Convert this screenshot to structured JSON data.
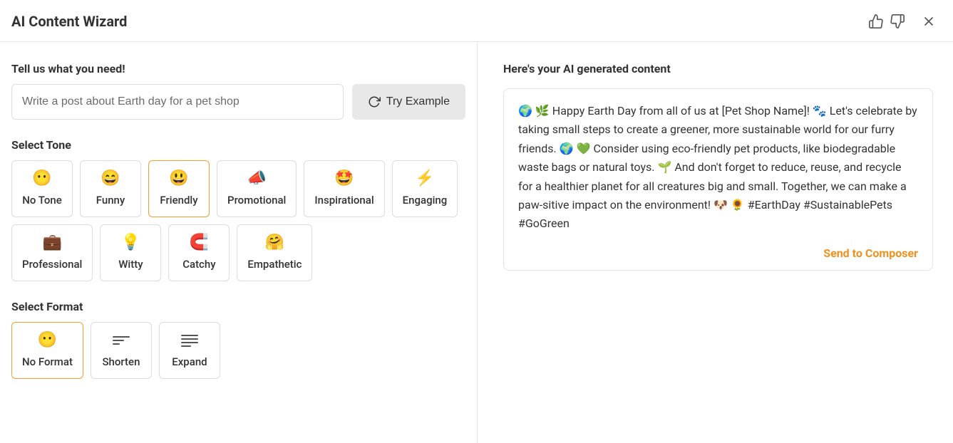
{
  "header": {
    "title": "AI Content Wizard"
  },
  "left": {
    "prompt_label": "Tell us what you need!",
    "prompt_value": "Write a post about Earth day for a pet shop",
    "try_example_label": "Try Example",
    "tone_label": "Select Tone",
    "tones": [
      {
        "emoji": "😶",
        "label": "No Tone",
        "selected": false
      },
      {
        "emoji": "😄",
        "label": "Funny",
        "selected": false
      },
      {
        "emoji": "😃",
        "label": "Friendly",
        "selected": true
      },
      {
        "emoji": "📣",
        "label": "Promotional",
        "selected": false
      },
      {
        "emoji": "🤩",
        "label": "Inspirational",
        "selected": false
      },
      {
        "emoji": "⚡",
        "label": "Engaging",
        "selected": false
      },
      {
        "emoji": "💼",
        "label": "Professional",
        "selected": false
      },
      {
        "emoji": "💡",
        "label": "Witty",
        "selected": false
      },
      {
        "emoji": "🧲",
        "label": "Catchy",
        "selected": false
      },
      {
        "emoji": "🤗",
        "label": "Empathetic",
        "selected": false
      }
    ],
    "format_label": "Select Format",
    "formats": [
      {
        "icon": "emoji",
        "emoji": "😶",
        "label": "No Format",
        "selected": true
      },
      {
        "icon": "shorten",
        "label": "Shorten",
        "selected": false
      },
      {
        "icon": "expand",
        "label": "Expand",
        "selected": false
      }
    ]
  },
  "right": {
    "title": "Here's your AI generated content",
    "output": "🌍 🌿 Happy Earth Day from all of us at [Pet Shop Name]! 🐾 Let's celebrate by taking small steps to create a greener, more sustainable world for our furry friends. 🌍 💚 Consider using eco-friendly pet products, like biodegradable waste bags or natural toys. 🌱 And don't forget to reduce, reuse, and recycle for a healthier planet for all creatures big and small. Together, we can make a paw-sitive impact on the environment! 🐶 🌻 #EarthDay #SustainablePets #GoGreen",
    "send_label": "Send to Composer"
  }
}
